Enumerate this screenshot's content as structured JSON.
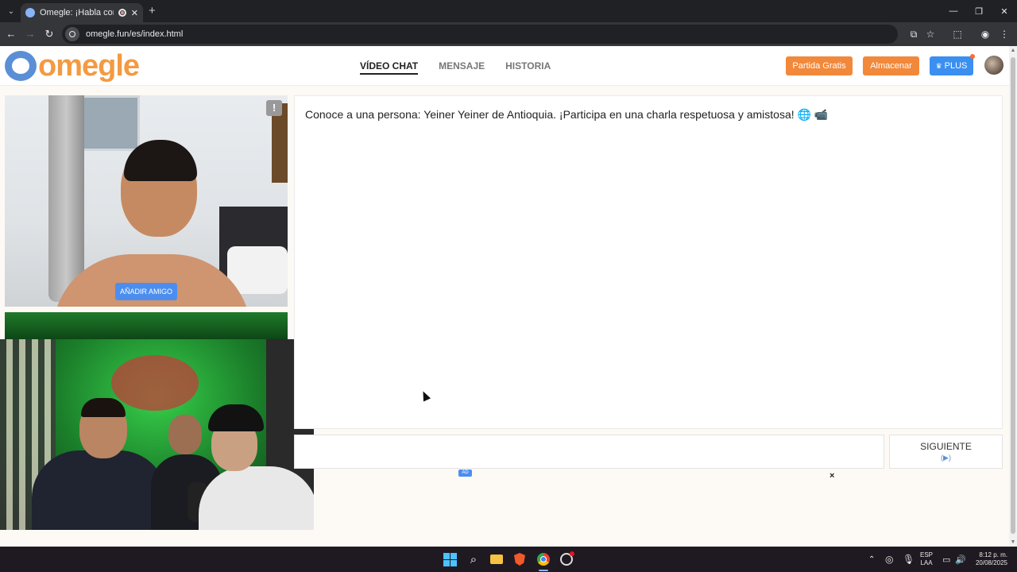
{
  "browser": {
    "tab_title": "Omegle: ¡Habla con Desconocidos!",
    "url": "omegle.fun/es/index.html",
    "new_tab": "+",
    "tab_close": "✕"
  },
  "header": {
    "logo_text": "omegle",
    "nav": {
      "video_chat": "VÍDEO CHAT",
      "message": "MENSAJE",
      "history": "HISTORIA"
    },
    "buttons": {
      "free_game": "Partida Gratis",
      "store": "Almacenar",
      "plus": "PLUS"
    },
    "colors": {
      "logo_orange": "#f39a42",
      "logo_blue": "#5a8fd6",
      "button_orange": "#f2883a",
      "button_blue": "#3b8ff0"
    }
  },
  "video": {
    "report_label": "!",
    "add_friend": "AÑADIR AMIGO"
  },
  "chat": {
    "intro_message": "Conoce a una persona: Yeiner Yeiner de Antioquia. ¡Participa en una charla respetuosa y amistosa! 🌐 📹"
  },
  "controls": {
    "next_label": "SIGUIENTE",
    "next_hint": "(▶)",
    "ad_badge": "AD",
    "ad_close": "×"
  },
  "taskbar": {
    "language_top": "ESP",
    "language_bottom": "LAA",
    "time": "8:12 p. m.",
    "date": "20/08/2025"
  }
}
